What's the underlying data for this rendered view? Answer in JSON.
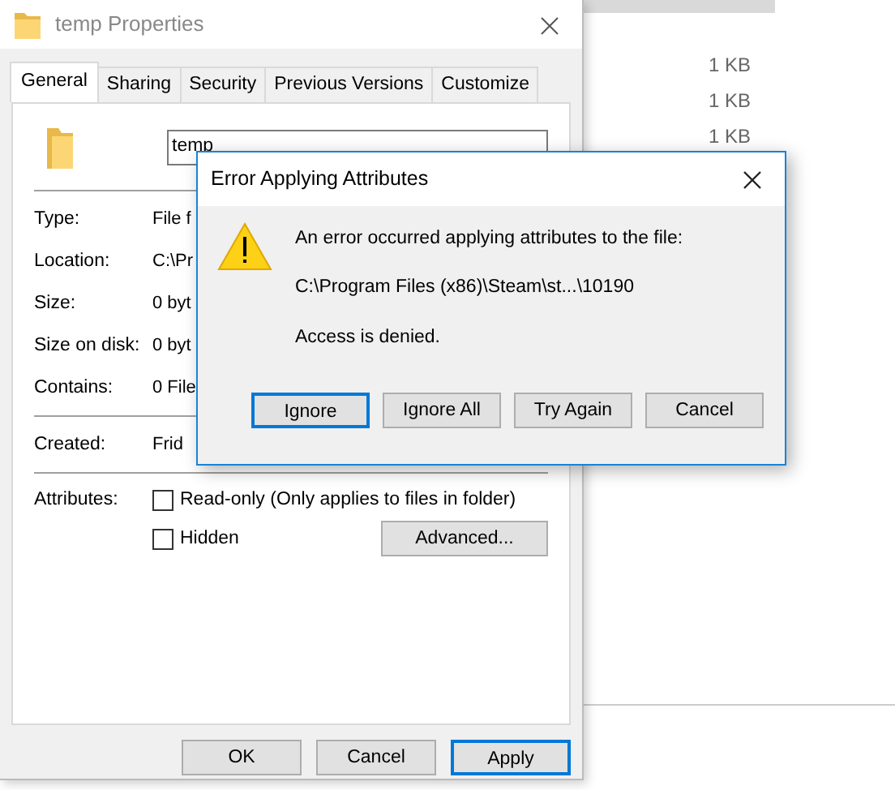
{
  "background_window": {
    "sizes": [
      "1 KB",
      "1 KB",
      "1 KB"
    ]
  },
  "properties": {
    "title": "temp Properties",
    "tabs": [
      {
        "label": "General",
        "selected": true
      },
      {
        "label": "Sharing",
        "selected": false
      },
      {
        "label": "Security",
        "selected": false
      },
      {
        "label": "Previous Versions",
        "selected": false
      },
      {
        "label": "Customize",
        "selected": false
      }
    ],
    "name": "temp",
    "fields": [
      {
        "label": "Type:",
        "value": "File f"
      },
      {
        "label": "Location:",
        "value": "C:\\Pr"
      },
      {
        "label": "Size:",
        "value": "0 byt"
      },
      {
        "label": "Size on disk:",
        "value": "0 byt"
      },
      {
        "label": "Contains:",
        "value": "0 File"
      }
    ],
    "created": {
      "label": "Created:",
      "value": "Frid"
    },
    "attributes": {
      "label": "Attributes:",
      "options": [
        {
          "label": "Read-only (Only applies to files in folder)",
          "checked": false
        },
        {
          "label": "Hidden",
          "checked": false
        }
      ],
      "advanced": "Advanced..."
    },
    "buttons": [
      {
        "label": "OK",
        "default": false
      },
      {
        "label": "Cancel",
        "default": false
      },
      {
        "label": "Apply",
        "default": true
      }
    ]
  },
  "error_dialog": {
    "title": "Error Applying Attributes",
    "message": "An error occurred applying attributes to the file:",
    "path": "C:\\Program Files (x86)\\Steam\\st...\\10190",
    "detail": "Access is denied.",
    "buttons": [
      {
        "label": "Ignore",
        "default": true
      },
      {
        "label": "Ignore All",
        "default": false
      },
      {
        "label": "Try Again",
        "default": false
      },
      {
        "label": "Cancel",
        "default": false
      }
    ]
  }
}
